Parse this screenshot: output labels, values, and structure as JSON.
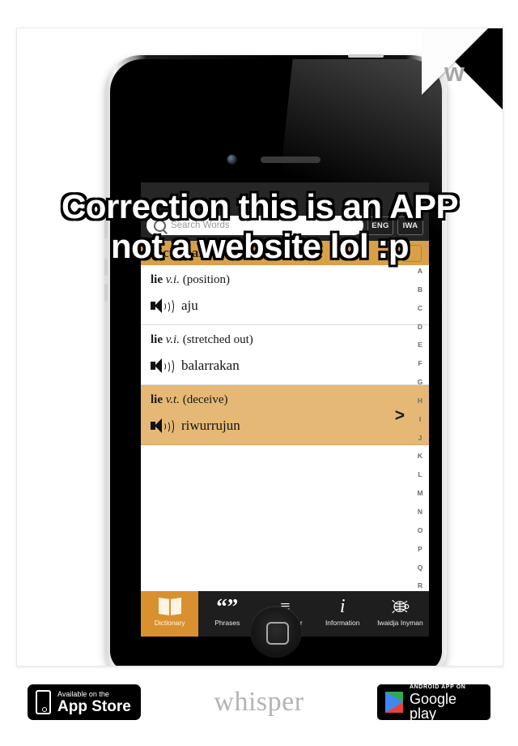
{
  "watermark": {
    "letter": "w"
  },
  "overlay": {
    "line1": "Correction this is an APP",
    "line2": "not a website lol :p"
  },
  "app": {
    "search": {
      "placeholder": "Search Words",
      "value": "",
      "icon": "search-icon"
    },
    "language_toggle": [
      {
        "label": "ENG",
        "active": true
      },
      {
        "label": "IWA",
        "active": false
      }
    ],
    "section_title": "Dictionary",
    "entries": [
      {
        "headword": "lie",
        "pos": "v.i.",
        "sense": "(position)",
        "translation": "aju",
        "highlighted": false,
        "chevron": ""
      },
      {
        "headword": "lie",
        "pos": "v.i.",
        "sense": "(stretched out)",
        "translation": "balarrakan",
        "highlighted": false,
        "chevron": ""
      },
      {
        "headword": "lie",
        "pos": "v.t.",
        "sense": "(deceive)",
        "translation": "riwurrujun",
        "highlighted": true,
        "chevron": ">"
      }
    ],
    "alphabet_index": [
      "A",
      "B",
      "C",
      "D",
      "E",
      "F",
      "G",
      "H",
      "I",
      "J",
      "K",
      "L",
      "M",
      "N",
      "O",
      "P",
      "Q",
      "R"
    ],
    "tabs": [
      {
        "label": "Dictionary",
        "icon": "open-book-icon",
        "active": true
      },
      {
        "label": "Phrases",
        "icon": "quote-marks-icon",
        "active": false
      },
      {
        "label": "Word Mixer",
        "icon": "word-mixer-icon",
        "active": false
      },
      {
        "label": "Information",
        "icon": "info-italic-i-icon",
        "active": false
      },
      {
        "label": "Iwaidja\nInyman",
        "icon": "turtle-icon",
        "active": false
      }
    ],
    "colors": {
      "accent_orange": "#d9912f",
      "highlight_tan": "#e5b875",
      "section_bar": "#d9a04a",
      "chrome_dark": "#1e1e1e"
    }
  },
  "footer": {
    "appstore": {
      "small": "Available on the",
      "big": "App Store"
    },
    "brand": "whisper",
    "googleplay": {
      "small": "ANDROID APP ON",
      "big": "Google",
      "big_light": " play"
    }
  }
}
